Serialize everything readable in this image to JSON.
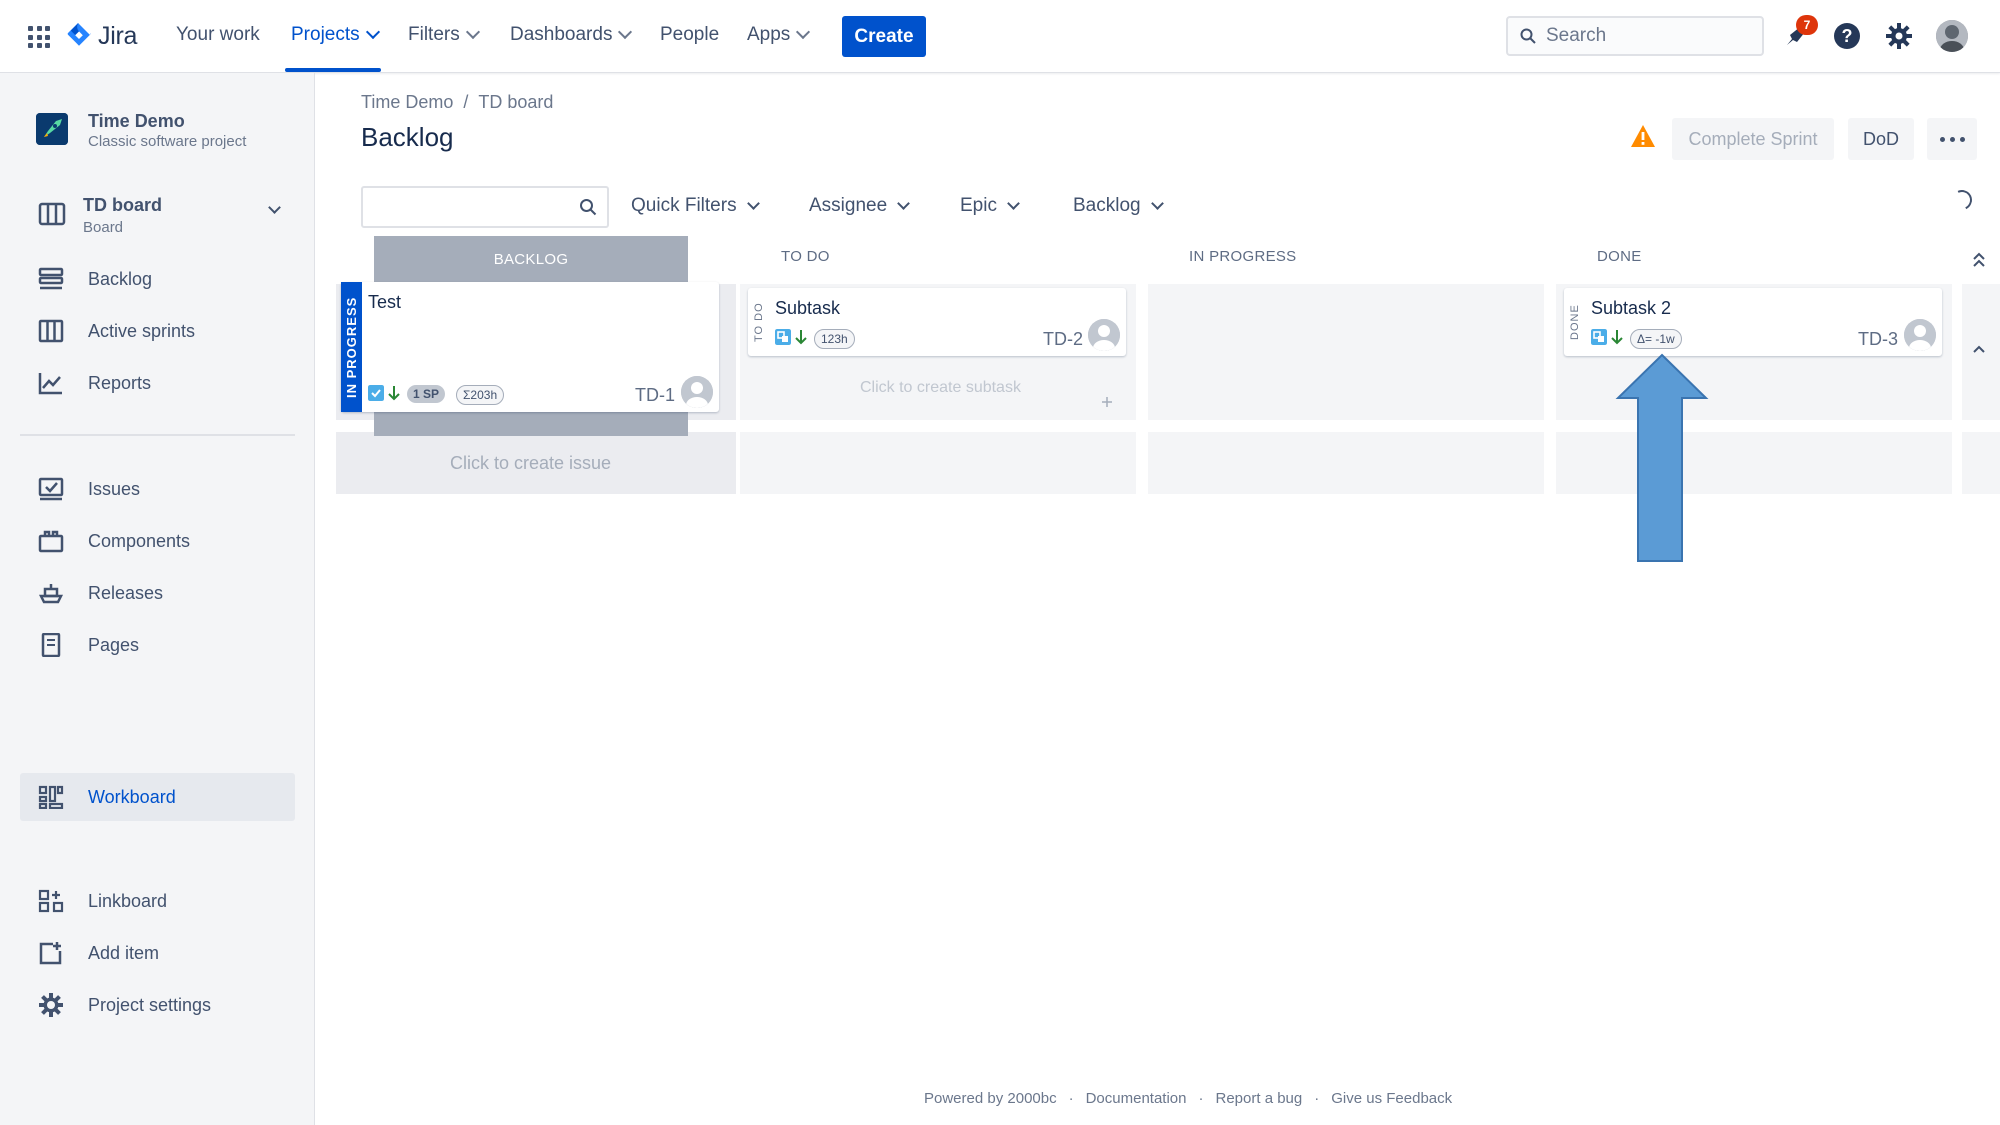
{
  "topnav": {
    "product": "Jira",
    "items": [
      {
        "label": "Your work"
      },
      {
        "label": "Projects"
      },
      {
        "label": "Filters"
      },
      {
        "label": "Dashboards"
      },
      {
        "label": "People"
      },
      {
        "label": "Apps"
      }
    ],
    "create_label": "Create",
    "search_placeholder": "Search",
    "notification_count": "7",
    "icons": [
      "app-switcher-icon",
      "jira-logo-icon",
      "search-icon",
      "notifications-icon",
      "help-icon",
      "settings-icon",
      "avatar"
    ]
  },
  "sidebar": {
    "project_name": "Time Demo",
    "project_type": "Classic software project",
    "board_name": "TD board",
    "board_sub": "Board",
    "items": [
      {
        "label": "Backlog"
      },
      {
        "label": "Active sprints"
      },
      {
        "label": "Reports"
      },
      {
        "label": "Issues"
      },
      {
        "label": "Components"
      },
      {
        "label": "Releases"
      },
      {
        "label": "Pages"
      },
      {
        "label": "Workboard"
      },
      {
        "label": "Linkboard"
      },
      {
        "label": "Add item"
      },
      {
        "label": "Project settings"
      }
    ]
  },
  "main": {
    "breadcrumb": [
      "Time Demo",
      "/",
      "TD board"
    ],
    "title": "Backlog",
    "buttons": {
      "complete_sprint": "Complete Sprint",
      "dod": "DoD"
    },
    "filters": [
      "Quick Filters",
      "Assignee",
      "Epic",
      "Backlog"
    ],
    "columns": [
      "BACKLOG",
      "TO DO",
      "IN PROGRESS",
      "DONE"
    ],
    "cards": [
      {
        "title": "Test",
        "key": "TD-1",
        "status": "IN PROGRESS",
        "sp": "1 SP",
        "time": "Σ203h"
      },
      {
        "title": "Subtask",
        "key": "TD-2",
        "status": "TO DO",
        "time": "123h"
      },
      {
        "title": "Subtask 2",
        "key": "TD-3",
        "status": "DONE",
        "time": "Δ= -1w"
      }
    ],
    "create_subtask": "Click to create subtask",
    "create_issue": "Click to create issue"
  },
  "footer": [
    "Powered by 2000bc",
    "·",
    "Documentation",
    "·",
    "Report a bug",
    "·",
    "Give us Feedback"
  ],
  "colors": {
    "brand": "#0052cc",
    "in_progress_strip": "#0052cc",
    "arrow": "#5b9bd5"
  }
}
